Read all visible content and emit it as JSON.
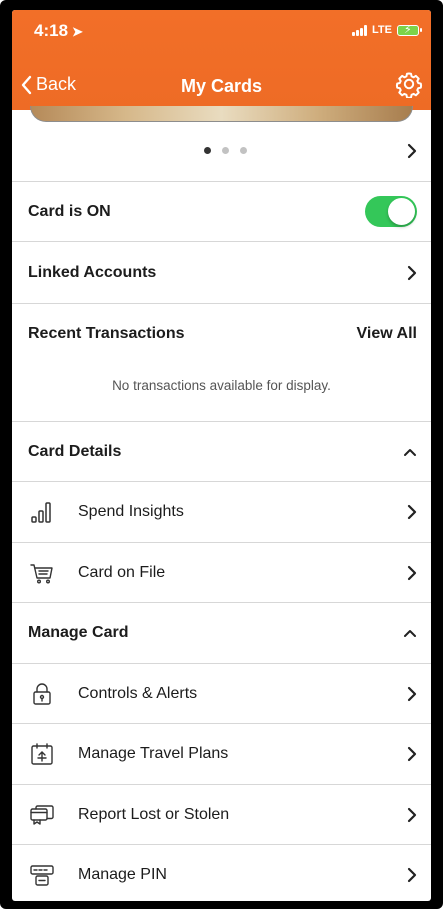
{
  "status_bar": {
    "time": "4:18",
    "network": "LTE"
  },
  "nav": {
    "back_label": "Back",
    "title": "My Cards"
  },
  "pager": {
    "page_count": 3,
    "active_index": 0
  },
  "card_status": {
    "label": "Card is ON",
    "enabled": true
  },
  "linked_accounts": {
    "label": "Linked Accounts"
  },
  "recent_transactions": {
    "label": "Recent Transactions",
    "view_all": "View All",
    "empty_message": "No transactions available for display."
  },
  "card_details": {
    "label": "Card Details",
    "items": [
      {
        "label": "Spend Insights",
        "icon": "bar-chart-icon"
      },
      {
        "label": "Card on File",
        "icon": "shopping-cart-icon"
      }
    ]
  },
  "manage_card": {
    "label": "Manage Card",
    "items": [
      {
        "label": "Controls & Alerts",
        "icon": "lock-icon"
      },
      {
        "label": "Manage Travel Plans",
        "icon": "travel-calendar-icon"
      },
      {
        "label": "Report Lost or Stolen",
        "icon": "lost-cards-icon"
      },
      {
        "label": "Manage PIN",
        "icon": "pin-pad-icon"
      }
    ]
  },
  "colors": {
    "header": "#f0702a",
    "toggle_on": "#34c759"
  }
}
